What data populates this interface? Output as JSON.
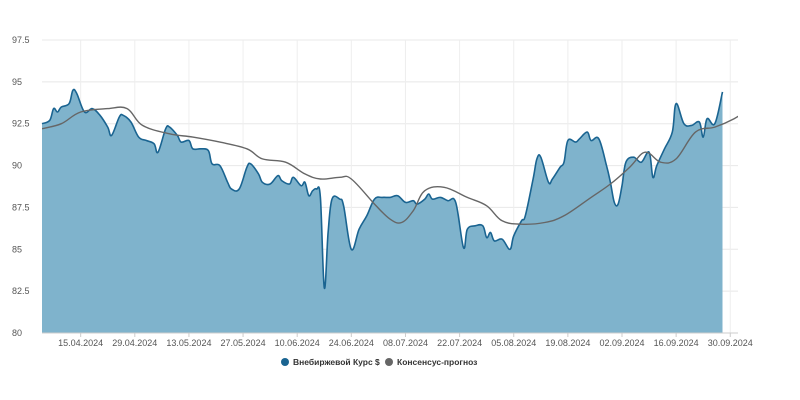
{
  "chart_data": {
    "type": "area",
    "title": "",
    "xlabel": "",
    "ylabel": "",
    "ylim": [
      80,
      97.5
    ],
    "xlim": [
      "2024-04-05",
      "2024-10-02"
    ],
    "y_ticks": [
      {
        "value": 80,
        "label": "80"
      },
      {
        "value": 82.5,
        "label": "82.5"
      },
      {
        "value": 85,
        "label": "85"
      },
      {
        "value": 87.5,
        "label": "87.5"
      },
      {
        "value": 90,
        "label": "90"
      },
      {
        "value": 92.5,
        "label": "92.5"
      },
      {
        "value": 95,
        "label": "95"
      },
      {
        "value": 97.5,
        "label": "97.5"
      }
    ],
    "x_ticks": [
      {
        "date": "2024-04-15",
        "label": "15.04.2024"
      },
      {
        "date": "2024-04-29",
        "label": "29.04.2024"
      },
      {
        "date": "2024-05-13",
        "label": "13.05.2024"
      },
      {
        "date": "2024-05-27",
        "label": "27.05.2024"
      },
      {
        "date": "2024-06-10",
        "label": "10.06.2024"
      },
      {
        "date": "2024-06-24",
        "label": "24.06.2024"
      },
      {
        "date": "2024-07-08",
        "label": "08.07.2024"
      },
      {
        "date": "2024-07-22",
        "label": "22.07.2024"
      },
      {
        "date": "2024-08-05",
        "label": "05.08.2024"
      },
      {
        "date": "2024-08-19",
        "label": "19.08.2024"
      },
      {
        "date": "2024-09-02",
        "label": "02.09.2024"
      },
      {
        "date": "2024-09-16",
        "label": "16.09.2024"
      },
      {
        "date": "2024-09-30",
        "label": "30.09.2024"
      }
    ],
    "grid": true,
    "legend_position": "bottom-center",
    "series": [
      {
        "name": "Внебиржевой Курс $",
        "type": "area",
        "line_color": "#1a6491",
        "fill_color": "#7fb3cc",
        "points": [
          [
            "2024-04-05",
            92.5
          ],
          [
            "2024-04-07",
            92.7
          ],
          [
            "2024-04-08",
            93.4
          ],
          [
            "2024-04-09",
            93.2
          ],
          [
            "2024-04-10",
            93.5
          ],
          [
            "2024-04-12",
            93.7
          ],
          [
            "2024-04-13",
            94.5
          ],
          [
            "2024-04-14",
            94.3
          ],
          [
            "2024-04-16",
            93.2
          ],
          [
            "2024-04-18",
            93.4
          ],
          [
            "2024-04-20",
            93.0
          ],
          [
            "2024-04-22",
            92.3
          ],
          [
            "2024-04-23",
            91.8
          ],
          [
            "2024-04-25",
            92.9
          ],
          [
            "2024-04-26",
            93.0
          ],
          [
            "2024-04-28",
            92.6
          ],
          [
            "2024-04-30",
            91.7
          ],
          [
            "2024-05-02",
            91.5
          ],
          [
            "2024-05-04",
            91.3
          ],
          [
            "2024-05-05",
            90.8
          ],
          [
            "2024-05-07",
            92.2
          ],
          [
            "2024-05-08",
            92.3
          ],
          [
            "2024-05-10",
            91.8
          ],
          [
            "2024-05-11",
            91.4
          ],
          [
            "2024-05-13",
            91.5
          ],
          [
            "2024-05-14",
            91.0
          ],
          [
            "2024-05-16",
            91.0
          ],
          [
            "2024-05-18",
            90.9
          ],
          [
            "2024-05-19",
            90.1
          ],
          [
            "2024-05-21",
            90.0
          ],
          [
            "2024-05-23",
            89.0
          ],
          [
            "2024-05-24",
            88.6
          ],
          [
            "2024-05-26",
            88.6
          ],
          [
            "2024-05-28",
            89.9
          ],
          [
            "2024-05-29",
            90.1
          ],
          [
            "2024-05-31",
            89.5
          ],
          [
            "2024-06-01",
            89.0
          ],
          [
            "2024-06-03",
            88.9
          ],
          [
            "2024-06-05",
            89.4
          ],
          [
            "2024-06-06",
            89.1
          ],
          [
            "2024-06-08",
            88.9
          ],
          [
            "2024-06-09",
            89.3
          ],
          [
            "2024-06-11",
            88.8
          ],
          [
            "2024-06-12",
            89.0
          ],
          [
            "2024-06-13",
            88.2
          ],
          [
            "2024-06-14",
            88.5
          ],
          [
            "2024-06-15",
            88.6
          ],
          [
            "2024-06-16",
            88.1
          ],
          [
            "2024-06-17",
            82.7
          ],
          [
            "2024-06-18",
            86.0
          ],
          [
            "2024-06-19",
            88.0
          ],
          [
            "2024-06-21",
            88.0
          ],
          [
            "2024-06-22",
            87.6
          ],
          [
            "2024-06-24",
            85.0
          ],
          [
            "2024-06-26",
            86.2
          ],
          [
            "2024-06-28",
            87.0
          ],
          [
            "2024-06-30",
            88.0
          ],
          [
            "2024-07-02",
            88.1
          ],
          [
            "2024-07-04",
            88.1
          ],
          [
            "2024-07-06",
            88.2
          ],
          [
            "2024-07-08",
            87.8
          ],
          [
            "2024-07-10",
            87.9
          ],
          [
            "2024-07-11",
            87.7
          ],
          [
            "2024-07-13",
            88.0
          ],
          [
            "2024-07-14",
            88.3
          ],
          [
            "2024-07-15",
            88.0
          ],
          [
            "2024-07-17",
            88.1
          ],
          [
            "2024-07-19",
            87.9
          ],
          [
            "2024-07-21",
            87.8
          ],
          [
            "2024-07-23",
            85.1
          ],
          [
            "2024-07-24",
            86.2
          ],
          [
            "2024-07-26",
            86.4
          ],
          [
            "2024-07-28",
            86.4
          ],
          [
            "2024-07-29",
            85.7
          ],
          [
            "2024-07-30",
            86.0
          ],
          [
            "2024-07-31",
            85.5
          ],
          [
            "2024-08-02",
            85.6
          ],
          [
            "2024-08-04",
            85.0
          ],
          [
            "2024-08-05",
            85.8
          ],
          [
            "2024-08-07",
            86.7
          ],
          [
            "2024-08-08",
            87.0
          ],
          [
            "2024-08-10",
            89.2
          ],
          [
            "2024-08-11",
            90.4
          ],
          [
            "2024-08-12",
            90.5
          ],
          [
            "2024-08-14",
            89.0
          ],
          [
            "2024-08-15",
            89.2
          ],
          [
            "2024-08-17",
            89.9
          ],
          [
            "2024-08-18",
            90.2
          ],
          [
            "2024-08-19",
            91.5
          ],
          [
            "2024-08-21",
            91.4
          ],
          [
            "2024-08-22",
            91.6
          ],
          [
            "2024-08-24",
            92.0
          ],
          [
            "2024-08-25",
            91.5
          ],
          [
            "2024-08-27",
            91.6
          ],
          [
            "2024-08-29",
            90.0
          ],
          [
            "2024-08-30",
            89.0
          ],
          [
            "2024-08-31",
            87.8
          ],
          [
            "2024-09-01",
            87.7
          ],
          [
            "2024-09-02",
            88.8
          ],
          [
            "2024-09-03",
            90.2
          ],
          [
            "2024-09-05",
            90.5
          ],
          [
            "2024-09-07",
            90.2
          ],
          [
            "2024-09-09",
            90.8
          ],
          [
            "2024-09-10",
            89.3
          ],
          [
            "2024-09-11",
            90.0
          ],
          [
            "2024-09-13",
            91.0
          ],
          [
            "2024-09-15",
            92.0
          ],
          [
            "2024-09-16",
            93.7
          ],
          [
            "2024-09-18",
            92.5
          ],
          [
            "2024-09-20",
            92.4
          ],
          [
            "2024-09-22",
            92.6
          ],
          [
            "2024-09-23",
            91.7
          ],
          [
            "2024-09-24",
            92.8
          ],
          [
            "2024-09-26",
            92.5
          ],
          [
            "2024-09-28",
            94.4
          ]
        ]
      },
      {
        "name": "Консенсус-прогноз",
        "type": "line",
        "line_color": "#666666",
        "points": [
          [
            "2024-04-05",
            92.2
          ],
          [
            "2024-04-10",
            92.5
          ],
          [
            "2024-04-15",
            93.2
          ],
          [
            "2024-04-22",
            93.4
          ],
          [
            "2024-04-27",
            93.4
          ],
          [
            "2024-05-01",
            92.4
          ],
          [
            "2024-05-08",
            91.9
          ],
          [
            "2024-05-14",
            91.7
          ],
          [
            "2024-05-21",
            91.4
          ],
          [
            "2024-05-28",
            91.0
          ],
          [
            "2024-06-01",
            90.4
          ],
          [
            "2024-06-07",
            90.2
          ],
          [
            "2024-06-12",
            89.5
          ],
          [
            "2024-06-16",
            89.2
          ],
          [
            "2024-06-21",
            89.3
          ],
          [
            "2024-06-24",
            89.2
          ],
          [
            "2024-06-30",
            87.7
          ],
          [
            "2024-07-04",
            86.8
          ],
          [
            "2024-07-07",
            86.6
          ],
          [
            "2024-07-10",
            87.3
          ],
          [
            "2024-07-13",
            88.5
          ],
          [
            "2024-07-18",
            88.7
          ],
          [
            "2024-07-24",
            88.1
          ],
          [
            "2024-07-29",
            87.6
          ],
          [
            "2024-08-02",
            86.7
          ],
          [
            "2024-08-07",
            86.5
          ],
          [
            "2024-08-13",
            86.6
          ],
          [
            "2024-08-18",
            87.0
          ],
          [
            "2024-08-25",
            88.1
          ],
          [
            "2024-08-30",
            88.9
          ],
          [
            "2024-09-04",
            89.9
          ],
          [
            "2024-09-08",
            90.8
          ],
          [
            "2024-09-12",
            90.2
          ],
          [
            "2024-09-16",
            90.4
          ],
          [
            "2024-09-21",
            92.0
          ],
          [
            "2024-09-26",
            92.3
          ],
          [
            "2024-10-01",
            92.8
          ],
          [
            "2024-10-05",
            93.4
          ]
        ]
      }
    ]
  },
  "legend": {
    "items": [
      {
        "label": "Внебиржевой Курс $",
        "marker_color": "#1a6491"
      },
      {
        "label": "Консенсус-прогноз",
        "marker_color": "#666666"
      }
    ]
  }
}
